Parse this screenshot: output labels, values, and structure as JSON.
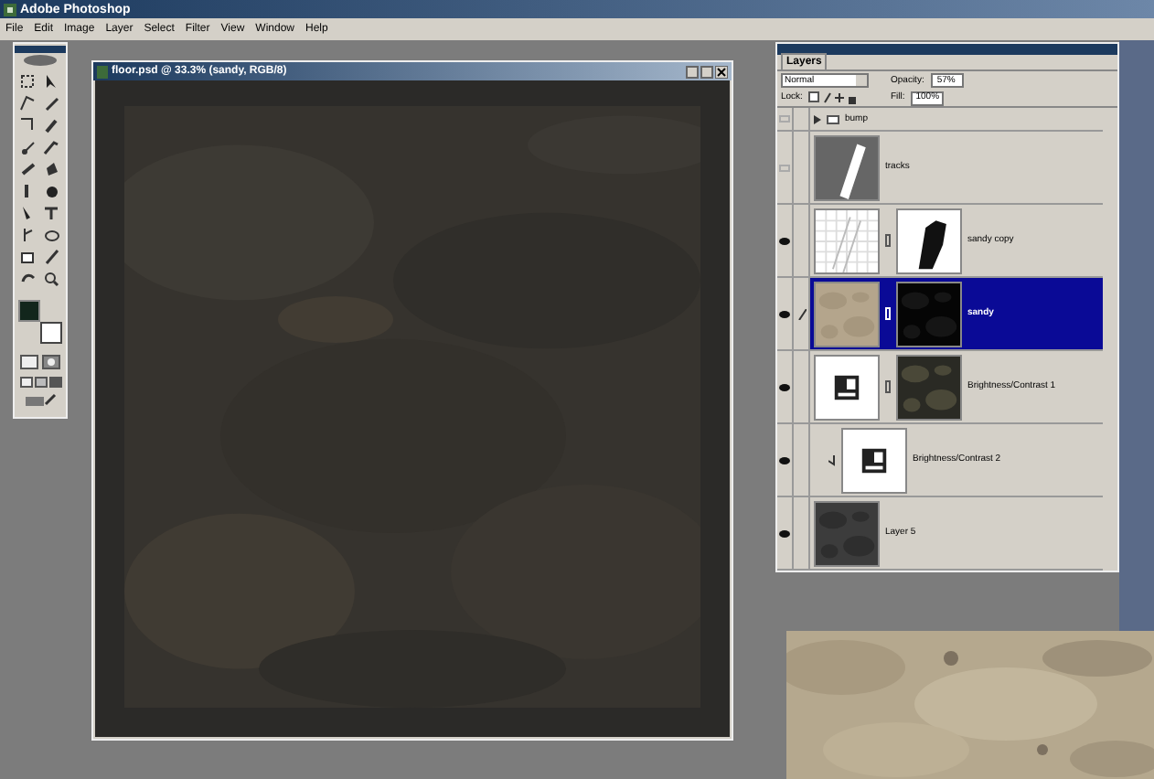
{
  "app": {
    "title": "Adobe Photoshop"
  },
  "menu": [
    "File",
    "Edit",
    "Image",
    "Layer",
    "Select",
    "Filter",
    "View",
    "Window",
    "Help"
  ],
  "document": {
    "title": "floor.psd @ 33.3% (sandy, RGB/8)"
  },
  "layers_panel": {
    "tab": "Layers",
    "blend_mode": "Normal",
    "opacity_label": "Opacity:",
    "opacity": "57%",
    "lock_label": "Lock:",
    "fill_label": "Fill:",
    "fill": "100%",
    "layers": [
      {
        "kind": "group",
        "name": "bump",
        "visible": false,
        "selected": false
      },
      {
        "kind": "layer",
        "name": "tracks",
        "visible": false,
        "selected": false
      },
      {
        "kind": "masked",
        "name": "sandy copy",
        "visible": true,
        "selected": false
      },
      {
        "kind": "masked",
        "name": "sandy",
        "visible": true,
        "selected": true
      },
      {
        "kind": "adjustment",
        "name": "Brightness/Contrast 1",
        "visible": true,
        "selected": false,
        "clipped": false
      },
      {
        "kind": "adjustment",
        "name": "Brightness/Contrast 2",
        "visible": true,
        "selected": false,
        "clipped": true
      },
      {
        "kind": "layer",
        "name": "Layer 5",
        "visible": true,
        "selected": false
      }
    ]
  }
}
